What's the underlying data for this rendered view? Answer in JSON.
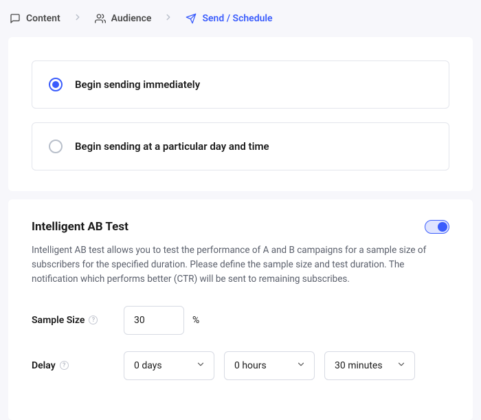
{
  "breadcrumb": {
    "items": [
      "Content",
      "Audience",
      "Send / Schedule"
    ],
    "active_index": 2
  },
  "send_options": {
    "immediate_label": "Begin sending immediately",
    "scheduled_label": "Begin sending at a particular day and time",
    "selected": "immediate"
  },
  "ab_test": {
    "title": "Intelligent AB Test",
    "enabled": true,
    "description": "Intelligent AB test allows you to test the performance of A and B campaigns for a sample size of subscribers for the specified duration. Please define the sample size and test duration. The notification which performs better (CTR) will be sent to remaining subscribes.",
    "sample_size": {
      "label": "Sample Size",
      "value": "30",
      "unit": "%"
    },
    "delay": {
      "label": "Delay",
      "days": "0 days",
      "hours": "0 hours",
      "minutes": "30 minutes"
    }
  }
}
